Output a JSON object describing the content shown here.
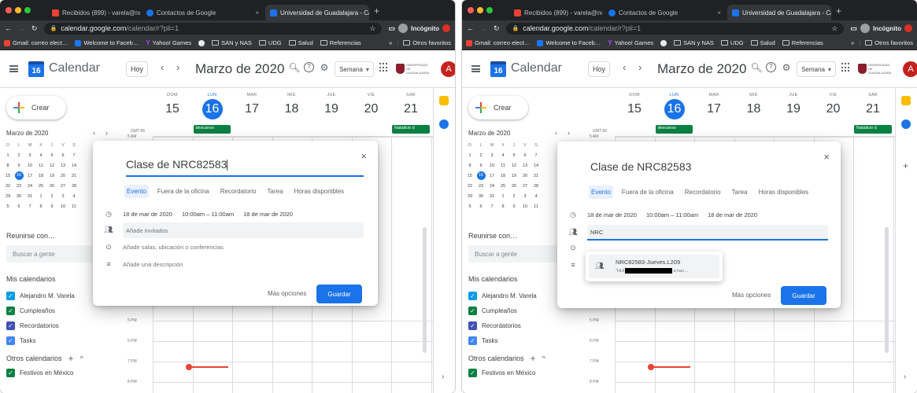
{
  "browser": {
    "tabs": [
      {
        "label": "Recibidos (899) - varela@noc…"
      },
      {
        "label": "Contactos de Google"
      },
      {
        "label": "Universidad de Guadalajara - Ca…"
      }
    ],
    "url_domain": "calendar.google.com",
    "url_path": "/calendar/r?pli=1",
    "incognito_label": "Incógnito",
    "bookmarks": [
      "Gmail: correo elect…",
      "Welcome to Faceb…",
      "Yahoo! Games",
      "SAN y NAS",
      "UDG",
      "Salud",
      "Referencias"
    ],
    "bookmarks_more": "»",
    "otros_favoritos": "Otros favoritos"
  },
  "header": {
    "app_icon_day": "16",
    "app_name": "Calendar",
    "today_button": "Hoy",
    "prev": "‹",
    "next": "›",
    "month": "Marzo de 2020",
    "search_icon": "search-icon",
    "help_icon": "help-icon",
    "settings_icon": "gear-icon",
    "view_button": "Semana",
    "view_caret": "▾",
    "logo_text": "UNIVERSIDAD DE GUADALAJARA",
    "avatar_letter": "A",
    "colors": {
      "primary": "#1a73e8",
      "avatar": "#c5221f",
      "allday_event": "#0b8043",
      "now_line": "#ea4335"
    }
  },
  "sidebar": {
    "create_button": "Crear",
    "mini_title": "Marzo de 2020",
    "mini_prev": "‹",
    "mini_next": "›",
    "weekdays": [
      "D",
      "L",
      "M",
      "X",
      "J",
      "V",
      "S"
    ],
    "weeks": [
      [
        "1",
        "2",
        "3",
        "4",
        "5",
        "6",
        "7"
      ],
      [
        "8",
        "9",
        "10",
        "11",
        "12",
        "13",
        "14"
      ],
      [
        "15",
        "16",
        "17",
        "18",
        "19",
        "20",
        "21"
      ],
      [
        "22",
        "23",
        "24",
        "25",
        "26",
        "27",
        "28"
      ],
      [
        "29",
        "30",
        "31",
        "1",
        "2",
        "3",
        "4"
      ],
      [
        "5",
        "6",
        "7",
        "8",
        "9",
        "10",
        "11"
      ]
    ],
    "today_day": "16",
    "meet_title": "Reunirse con…",
    "search_people": "Buscar a gente",
    "my_calendars_title": "Mis calendarios",
    "my_calendars": [
      {
        "name": "Alejandro M. Varela",
        "color": "#039be5"
      },
      {
        "name": "Cumpleaños",
        "color": "#0b8043"
      },
      {
        "name": "Recordatorios",
        "color": "#3f51b5"
      },
      {
        "name": "Tasks",
        "color": "#4285f4"
      }
    ],
    "other_calendars_title": "Otros calendarios",
    "other_add": "+",
    "other_collapse": "^",
    "other_calendars": [
      {
        "name": "Festivos en México",
        "color": "#0b8043"
      }
    ]
  },
  "week": {
    "days": [
      {
        "name": "DOM",
        "num": "15"
      },
      {
        "name": "LUN",
        "num": "16",
        "today": true
      },
      {
        "name": "MAR",
        "num": "17"
      },
      {
        "name": "MIÉ",
        "num": "18"
      },
      {
        "name": "JUE",
        "num": "19"
      },
      {
        "name": "VIE",
        "num": "20"
      },
      {
        "name": "SÁB",
        "num": "21"
      }
    ],
    "gmt": "GMT-06",
    "allday_events": [
      {
        "day": "LUN",
        "label": "descanso"
      },
      {
        "day": "SÁB",
        "label": "Natalicio d"
      }
    ],
    "hour_labels": [
      "5 AM",
      "5 PM",
      "6 PM",
      "7 PM",
      "8 PM"
    ]
  },
  "dialog": {
    "close": "×",
    "title_left": "Clase de NRC82583",
    "title_right": "Clase de NRC82583",
    "tabs": [
      "Evento",
      "Fuera de la oficina",
      "Recordatorio",
      "Tarea",
      "Horas disponibles"
    ],
    "selected_tab": "Evento",
    "date_start": "18 de mar de 2020",
    "time_range": "10:00am  –  11:00am",
    "date_end": "18 de mar de 2020",
    "guests_placeholder": "Añade invitados",
    "guests_typed": "NRC",
    "location_placeholder": "Añadir salas, ubicación o conferencias",
    "description_placeholder": "Añade una descripción",
    "more_options": "Más opciones",
    "save": "Guardar",
    "suggestion_name": "NRC82583-Jueves.L209",
    "suggestion_prefix": "\"HUI",
    "suggestion_suffix": "a han…"
  }
}
